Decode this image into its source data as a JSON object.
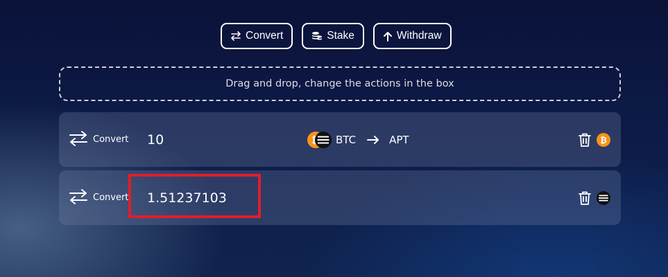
{
  "toolbar": {
    "convert_label": "Convert",
    "stake_label": "Stake",
    "withdraw_label": "Withdraw"
  },
  "drop_zone": {
    "text": "Drag and drop, change the actions in the box"
  },
  "actions": [
    {
      "type_label": "Convert",
      "amount": "10",
      "from": "BTC",
      "to": "APT",
      "asset_icon": "btc-coin-icon"
    },
    {
      "type_label": "Convert",
      "amount": "1.51237103",
      "asset_icon": "apt-coin-icon"
    }
  ],
  "colors": {
    "highlight": "#e01e2a",
    "btc_orange": "#f7931a",
    "apt_black": "#111111"
  }
}
